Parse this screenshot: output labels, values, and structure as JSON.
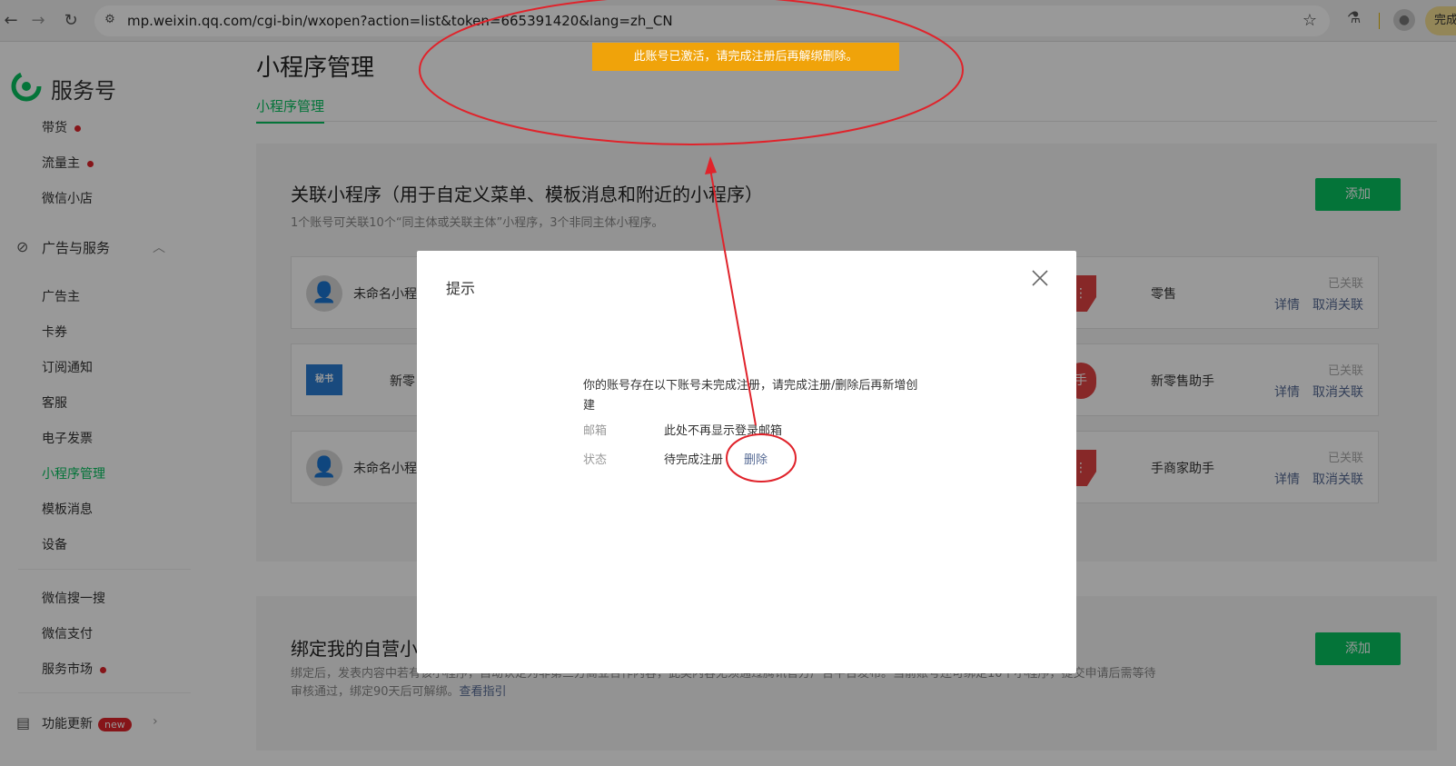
{
  "browser": {
    "url": "mp.weixin.qq.com/cgi-bin/wxopen?action=list&token=665391420&lang=zh_CN",
    "profile_pill": "完成"
  },
  "sidebar": {
    "brand": "服务号",
    "items_top": [
      {
        "label": "带货",
        "dot": true
      },
      {
        "label": "流量主",
        "dot": true
      },
      {
        "label": "微信小店",
        "dot": false
      }
    ],
    "section_ads": "广告与服务",
    "items_ads": [
      {
        "label": "广告主"
      },
      {
        "label": "卡券"
      },
      {
        "label": "订阅通知"
      },
      {
        "label": "客服"
      },
      {
        "label": "电子发票"
      },
      {
        "label": "小程序管理",
        "active": true
      },
      {
        "label": "模板消息"
      },
      {
        "label": "设备"
      }
    ],
    "items_bottom": [
      {
        "label": "微信搜一搜"
      },
      {
        "label": "微信支付"
      },
      {
        "label": "服务市场",
        "dot": true
      }
    ],
    "footer_label": "功能更新",
    "footer_badge": "new"
  },
  "main": {
    "title": "小程序管理",
    "tab": "小程序管理",
    "card1": {
      "title": "关联小程序（用于自定义菜单、模板消息和附近的小程序）",
      "subtitle": "1个账号可关联10个“同主体或关联主体”小程序，3个非同主体小程序。",
      "add_label": "添加",
      "items": [
        {
          "left_name": "未命名小程",
          "right_name": "零售",
          "status": "已关联",
          "detail": "详情",
          "unlink": "取消关联"
        },
        {
          "left_name": "新零",
          "logo_text": "秘书",
          "right_name": "新零售助手",
          "status": "已关联",
          "detail": "详情",
          "unlink": "取消关联"
        },
        {
          "left_name": "未命名小程",
          "right_name": "手商家助手",
          "status": "已关联",
          "detail": "详情",
          "unlink": "取消关联"
        }
      ]
    },
    "card2": {
      "title": "绑定我的自营小",
      "add_label": "添加",
      "text_line1": "绑定后，发表内容中若有该小程序，自动认定为非第三方商业合作内容，此类内容无须通过腾讯官方广告平台发布。当前账号还可绑定10个小程序，提交申请后需等待",
      "text_line2": "审核通过，绑定90天后可解绑。",
      "guide_link": "查看指引"
    }
  },
  "toast": "此账号已激活，请完成注册后再解绑删除。",
  "dialog": {
    "title": "提示",
    "message": "你的账号存在以下账号未完成注册，请完成注册/删除后再新增创建",
    "email_label": "邮箱",
    "email_value": "此处不再显示登录邮箱",
    "status_label": "状态",
    "status_value": "待完成注册",
    "delete_label": "删除"
  },
  "colors": {
    "accent": "#07c160",
    "link": "#576b95",
    "toast_bg": "#f0a30a",
    "annotation": "#e0232b"
  }
}
